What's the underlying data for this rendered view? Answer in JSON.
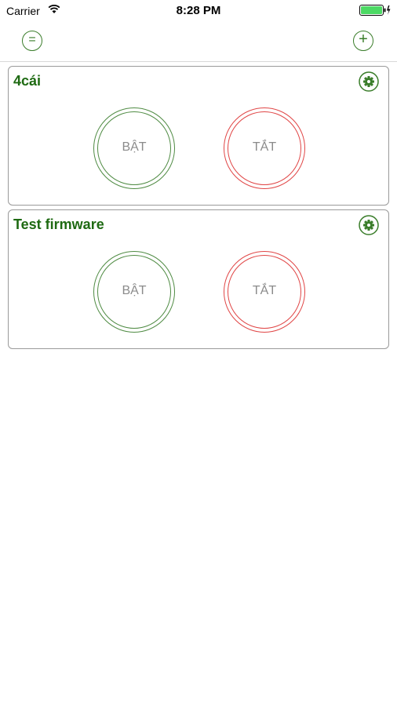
{
  "status_bar": {
    "carrier": "Carrier",
    "time": "8:28 PM",
    "wifi_icon": "wifi-icon",
    "battery_icon": "battery-charging-icon"
  },
  "nav": {
    "menu_symbol": "=",
    "add_symbol": "+",
    "menu_icon": "menu-icon",
    "add_icon": "plus-icon"
  },
  "devices": [
    {
      "name": "4cái",
      "on_label": "BẬT",
      "off_label": "TẮT"
    },
    {
      "name": "Test firmware",
      "on_label": "BẬT",
      "off_label": "TẮT"
    }
  ],
  "colors": {
    "accent_green": "#3a7d2a",
    "title_green": "#1e6a12",
    "off_red": "#e04545",
    "battery_green": "#4cd964"
  }
}
